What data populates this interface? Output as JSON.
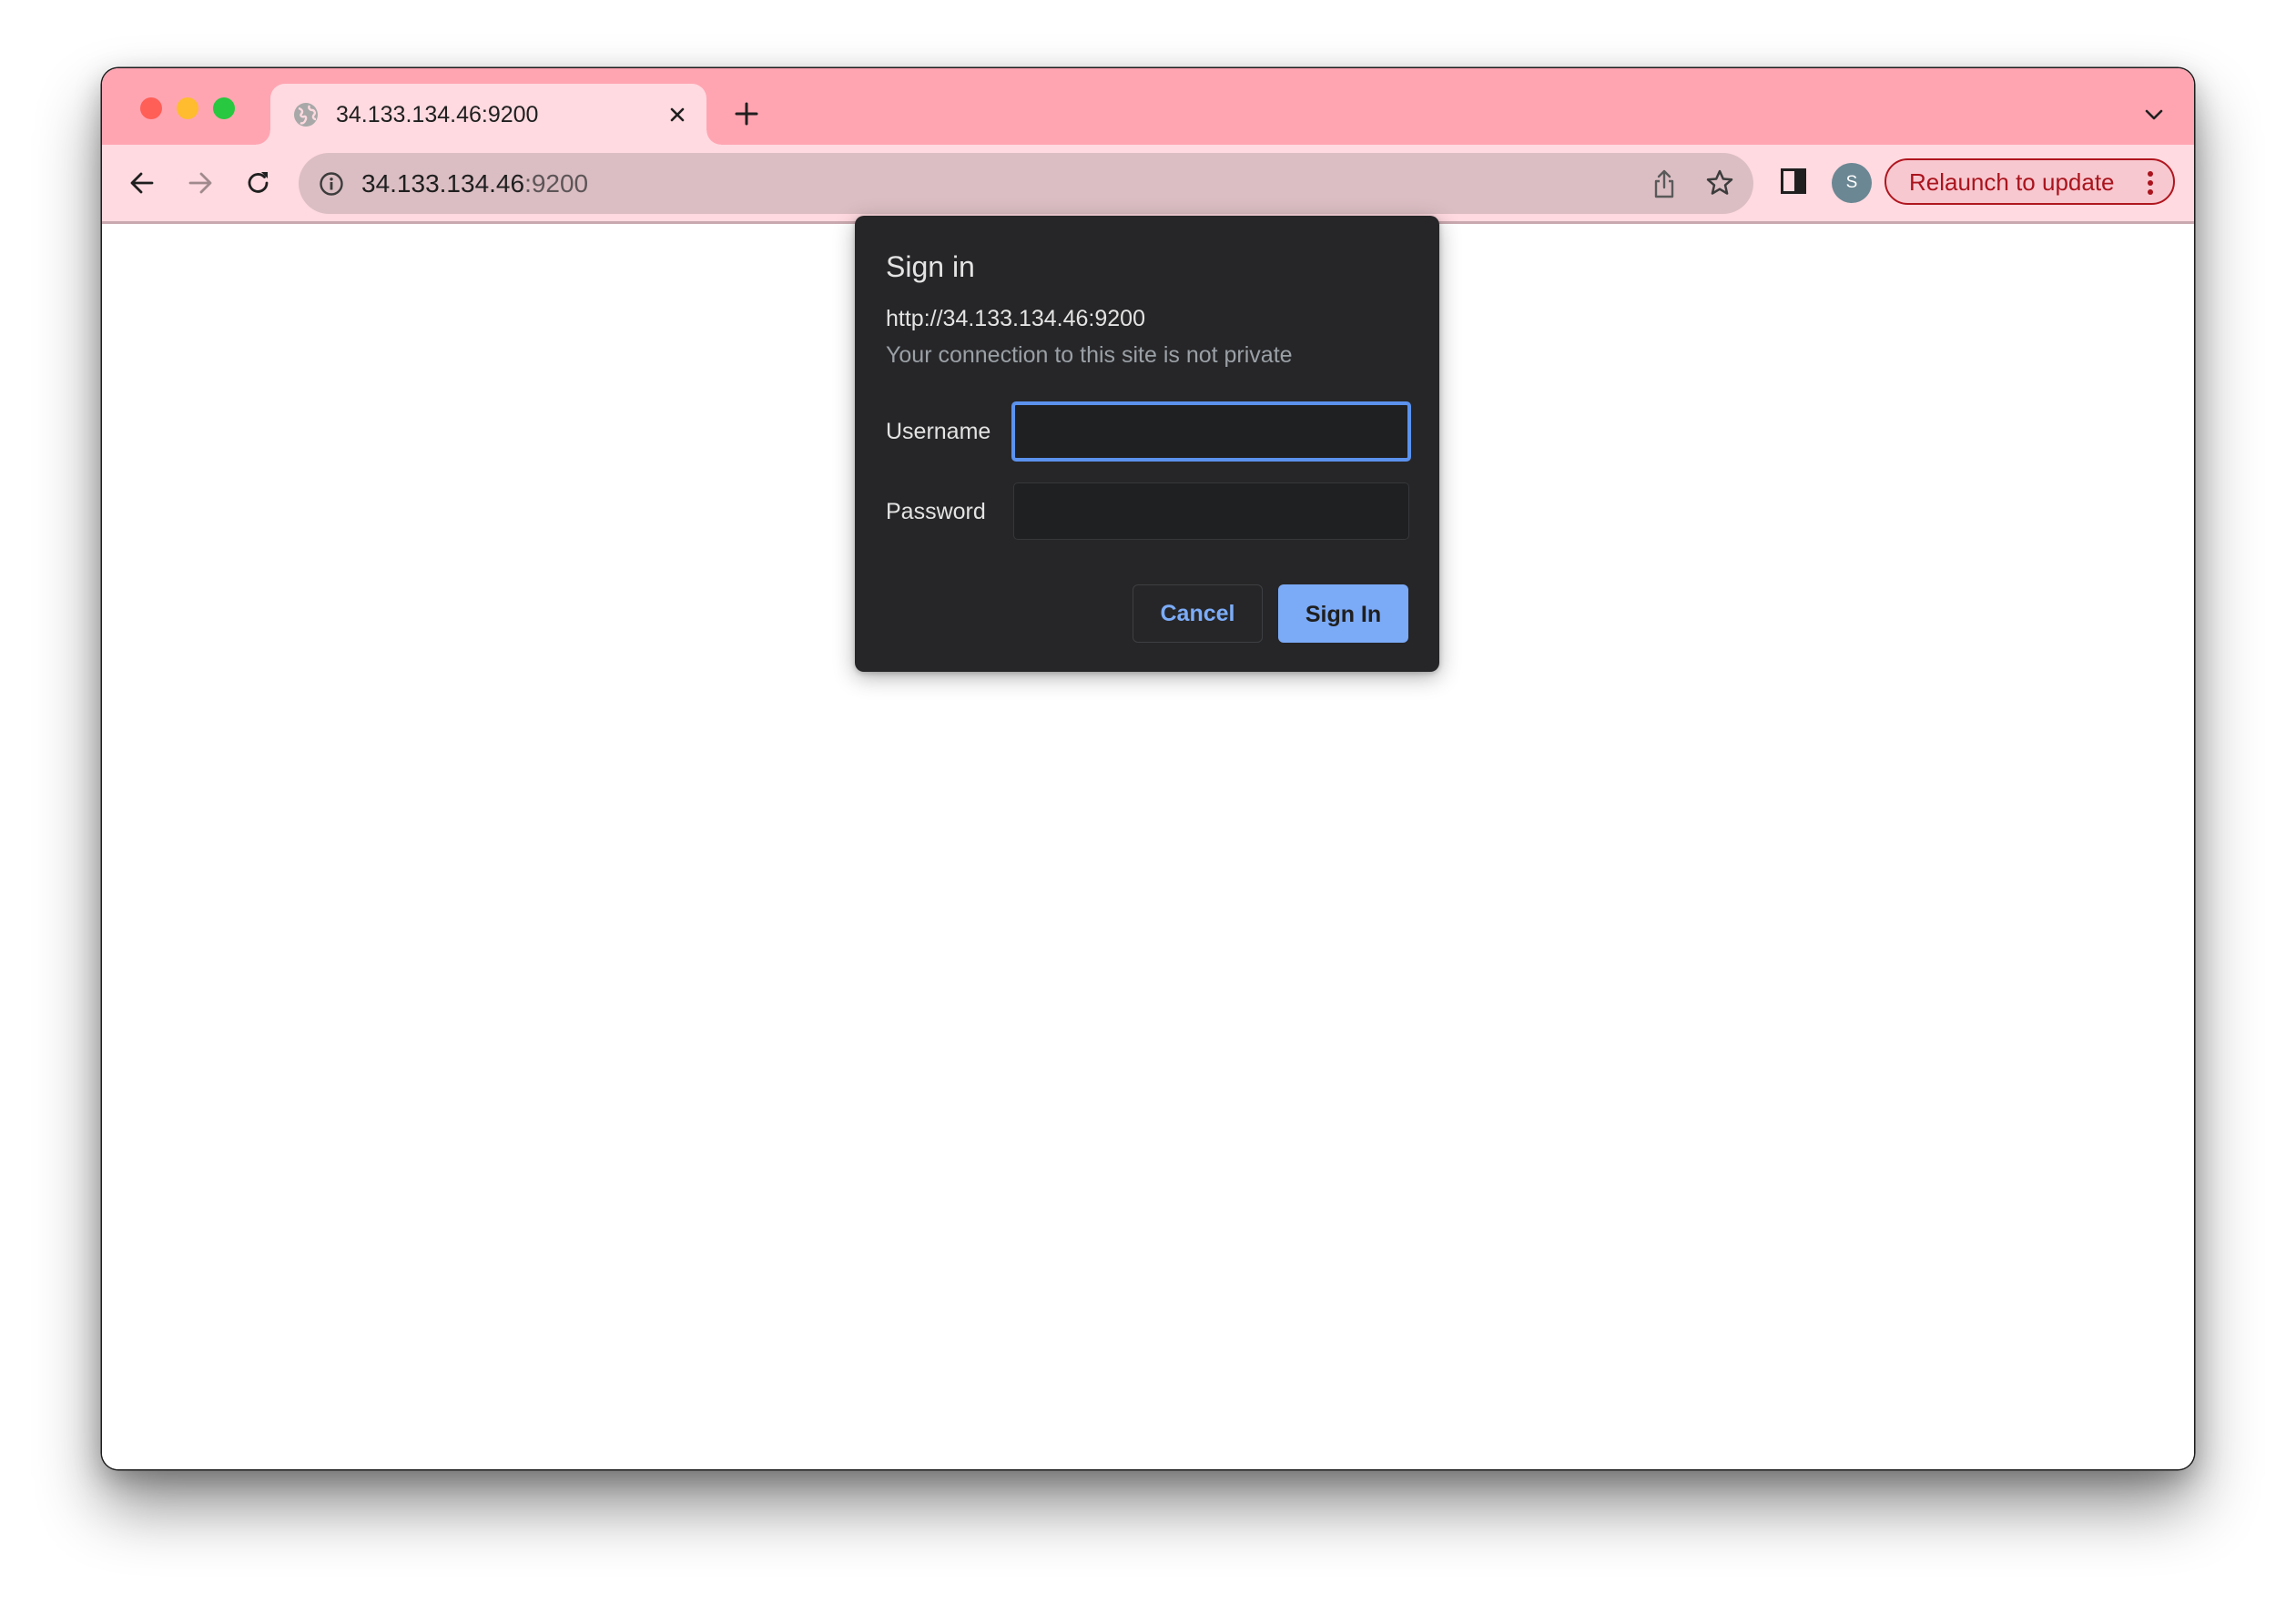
{
  "window": {
    "traffic_lights": [
      "close",
      "minimize",
      "zoom"
    ]
  },
  "tabs": [
    {
      "title": "34.133.134.46:9200",
      "favicon": "globe-icon",
      "active": true
    }
  ],
  "tabstrip": {
    "new_tab_icon": "plus-icon",
    "tab_search_icon": "chevron-down-icon"
  },
  "toolbar": {
    "back_icon": "arrow-left-icon",
    "forward_icon": "arrow-right-icon",
    "reload_icon": "reload-icon",
    "omnibox": {
      "security_icon": "info-icon",
      "host": "34.133.134.46",
      "port": ":9200",
      "share_icon": "share-icon",
      "bookmark_icon": "star-icon"
    },
    "side_panel_icon": "side-panel-icon",
    "profile_initial": "S",
    "relaunch_label": "Relaunch to update",
    "menu_icon": "kebab-menu-icon"
  },
  "dialog": {
    "title": "Sign in",
    "origin": "http://34.133.134.46:9200",
    "warning": "Your connection to this site is not private",
    "username_label": "Username",
    "username_value": "",
    "password_label": "Password",
    "password_value": "",
    "cancel_label": "Cancel",
    "signin_label": "Sign In"
  },
  "colors": {
    "tabstrip": "#ffa5b2",
    "toolbar": "#ffdae0",
    "omnibox": "#dbbec3",
    "dialog_bg": "#262628",
    "accent_blue": "#7baaf7",
    "focus_ring": "#5b92ee",
    "relaunch_red": "#a9141d"
  }
}
